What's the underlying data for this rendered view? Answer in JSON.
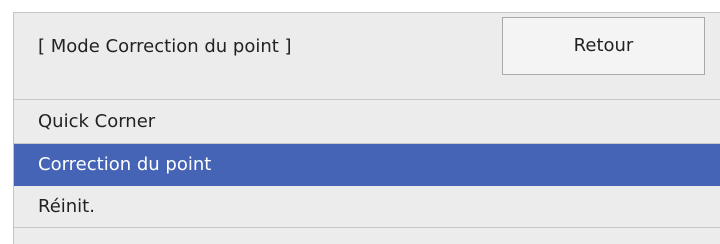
{
  "header": {
    "mode_title": "[ Mode Correction du point ]",
    "back_label": "Retour"
  },
  "menu": {
    "items": [
      {
        "label": "Quick Corner",
        "selected": false
      },
      {
        "label": "Correction du point",
        "selected": true
      },
      {
        "label": "Réinit.",
        "selected": false
      }
    ]
  },
  "colors": {
    "panel_bg": "#ececec",
    "selected_bg": "#4564b6",
    "selected_text": "#ffffff",
    "text": "#222222"
  }
}
